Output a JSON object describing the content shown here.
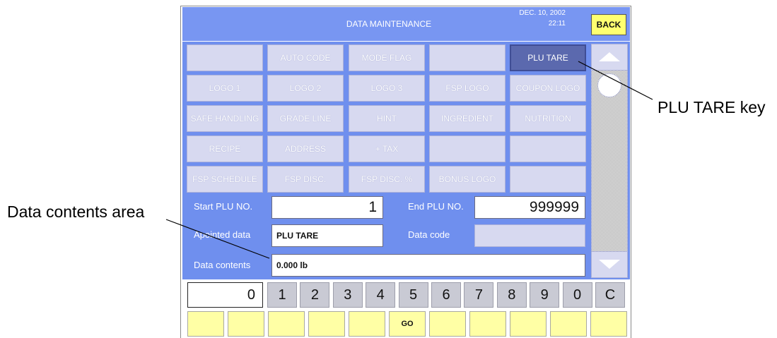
{
  "header": {
    "title": "DATA MAINTENANCE",
    "date": "DEC. 10, 2002",
    "time": "22:11",
    "back_label": "BACK"
  },
  "data_keys": [
    [
      {
        "label": "",
        "selected": false
      },
      {
        "label": "AUTO CODE",
        "selected": false
      },
      {
        "label": "MODE FLAG",
        "selected": false
      },
      {
        "label": "",
        "selected": false
      },
      {
        "label": "PLU TARE",
        "selected": true
      }
    ],
    [
      {
        "label": "LOGO 1",
        "selected": false
      },
      {
        "label": "LOGO 2",
        "selected": false
      },
      {
        "label": "LOGO 3",
        "selected": false
      },
      {
        "label": "FSP LOGO",
        "selected": false
      },
      {
        "label": "COUPON LOGO",
        "selected": false
      }
    ],
    [
      {
        "label": "SAFE HANDLING",
        "selected": false
      },
      {
        "label": "GRADE LINE",
        "selected": false
      },
      {
        "label": "HINT",
        "selected": false
      },
      {
        "label": "INGREDIENT",
        "selected": false
      },
      {
        "label": "NUTRITION",
        "selected": false
      }
    ],
    [
      {
        "label": "RECIPE",
        "selected": false
      },
      {
        "label": "ADDRESS",
        "selected": false
      },
      {
        "label": "+ TAX",
        "selected": false
      },
      {
        "label": "",
        "selected": false
      },
      {
        "label": "",
        "selected": false
      }
    ],
    [
      {
        "label": "FSP SCHEDULE",
        "selected": false
      },
      {
        "label": "FSP DISC.",
        "selected": false
      },
      {
        "label": "FSP DISC. %",
        "selected": false
      },
      {
        "label": "BONUS LOGO",
        "selected": false
      },
      {
        "label": "",
        "selected": false
      }
    ]
  ],
  "scrollbar": {
    "up_icon": "up-arrow-icon",
    "thumb_icon": "circle-thumb-icon",
    "down_icon": "down-arrow-icon"
  },
  "form": {
    "start_plu": {
      "label": "Start PLU NO.",
      "value": "1"
    },
    "end_plu": {
      "label": "End PLU NO.",
      "value": "999999"
    },
    "appointed_data": {
      "label": "Apointed data",
      "value": "PLU TARE"
    },
    "data_code": {
      "label": "Data code",
      "value": ""
    },
    "data_contents": {
      "label": "Data contents",
      "value": "0.000 lb"
    }
  },
  "keypad": {
    "display": "0",
    "keys": [
      "1",
      "2",
      "3",
      "4",
      "5",
      "6",
      "7",
      "8",
      "9",
      "0",
      "C"
    ]
  },
  "function_keys": [
    "",
    "",
    "",
    "",
    "",
    "GO",
    "",
    "",
    "",
    "",
    ""
  ],
  "callouts": {
    "plu_tare_key": "PLU TARE key",
    "data_contents_area": "Data contents area"
  },
  "colors": {
    "header_blue": "#7896F2",
    "panel_blue": "#6F8FEE",
    "key_lavender": "#D7D9F0",
    "key_selected": "#5B69AE",
    "keypad_gray": "#C9CAD4",
    "function_yellow": "#FFFFA5",
    "back_yellow": "#FFFF70"
  }
}
